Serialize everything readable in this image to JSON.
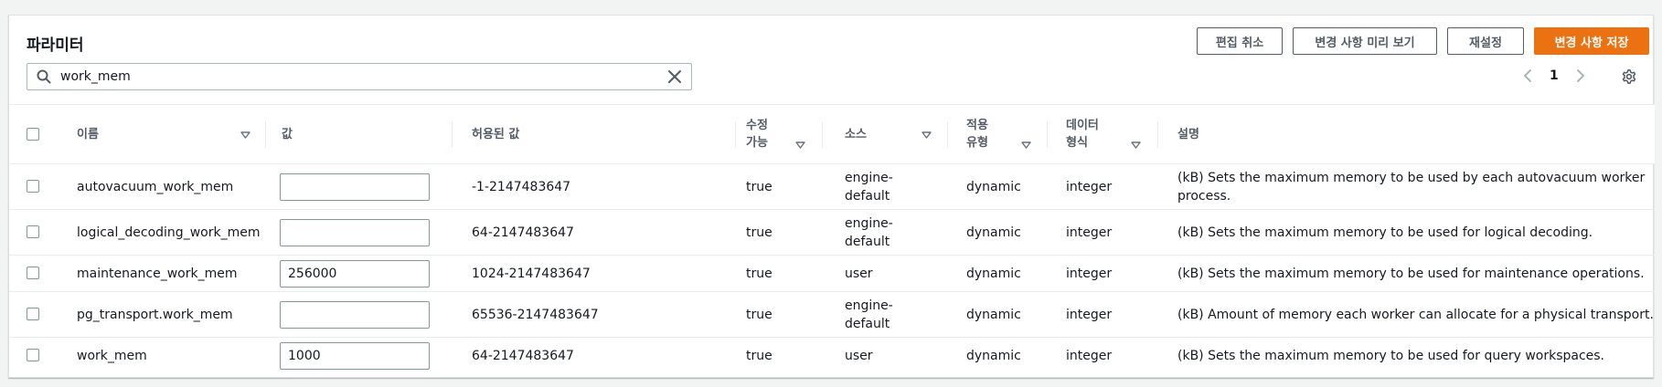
{
  "header": {
    "title": "파라미터",
    "buttons": {
      "cancel_edit": "편집 취소",
      "preview_changes": "변경 사항 미리 보기",
      "reset": "재설정",
      "save_changes": "변경 사항 저장"
    }
  },
  "search": {
    "value": "work_mem",
    "placeholder": ""
  },
  "pagination": {
    "current_page": "1"
  },
  "table": {
    "columns": {
      "name": "이름",
      "value": "값",
      "allowed_values": "허용된 값",
      "modifiable": "수정\n가능",
      "source": "소스",
      "apply_type": "적용\n유형",
      "data_type": "데이터\n형식",
      "description": "설명"
    },
    "rows": [
      {
        "name": "autovacuum_work_mem",
        "value": "",
        "allowed_values": "-1-2147483647",
        "modifiable": "true",
        "source": "engine-\ndefault",
        "apply_type": "dynamic",
        "data_type": "integer",
        "description": "(kB) Sets the maximum memory to be used by each autovacuum worker\nprocess."
      },
      {
        "name": "logical_decoding_work_mem",
        "value": "",
        "allowed_values": "64-2147483647",
        "modifiable": "true",
        "source": "engine-\ndefault",
        "apply_type": "dynamic",
        "data_type": "integer",
        "description": "(kB) Sets the maximum memory to be used for logical decoding."
      },
      {
        "name": "maintenance_work_mem",
        "value": "256000",
        "allowed_values": "1024-2147483647",
        "modifiable": "true",
        "source": "user",
        "apply_type": "dynamic",
        "data_type": "integer",
        "description": "(kB) Sets the maximum memory to be used for maintenance operations."
      },
      {
        "name": "pg_transport.work_mem",
        "value": "",
        "allowed_values": "65536-2147483647",
        "modifiable": "true",
        "source": "engine-\ndefault",
        "apply_type": "dynamic",
        "data_type": "integer",
        "description": "(kB) Amount of memory each worker can allocate for a physical transport."
      },
      {
        "name": "work_mem",
        "value": "1000",
        "allowed_values": "64-2147483647",
        "modifiable": "true",
        "source": "user",
        "apply_type": "dynamic",
        "data_type": "integer",
        "description": "(kB) Sets the maximum memory to be used for query workspaces."
      }
    ]
  },
  "colors": {
    "primary": "#ec7211",
    "border": "#eaeded",
    "text": "#16191f",
    "muted": "#545b64"
  },
  "icons": [
    "search-icon",
    "clear-icon",
    "chevron-left-icon",
    "chevron-right-icon",
    "gear-icon",
    "sort-icon"
  ]
}
